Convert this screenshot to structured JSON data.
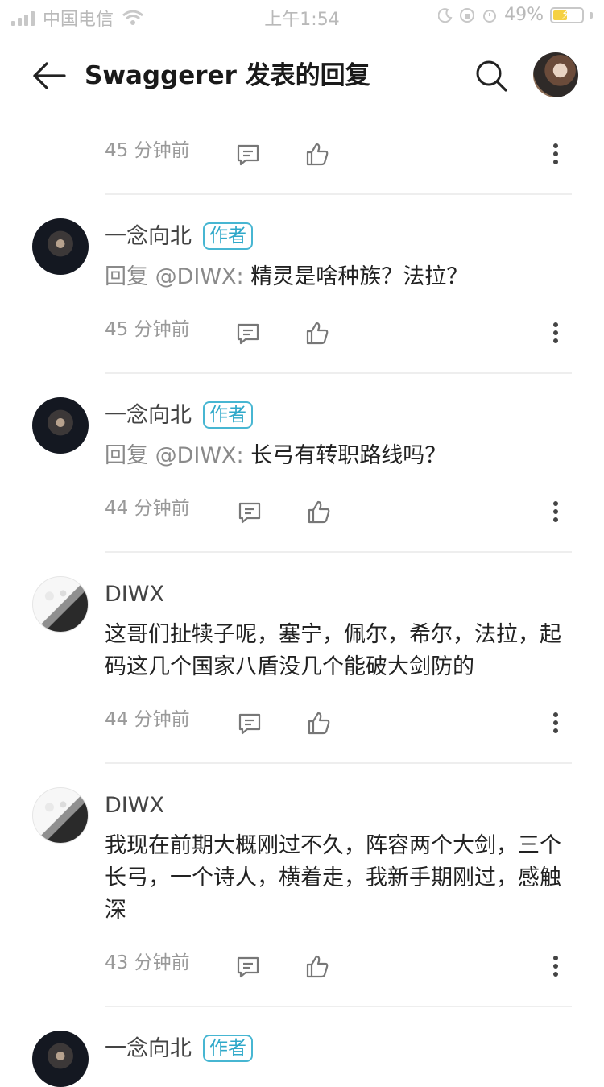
{
  "status": {
    "carrier": "中国电信",
    "time": "上午1:54",
    "battery": "49%",
    "battery_level": 0.49
  },
  "header": {
    "title": "Swaggerer 发表的回复",
    "back_icon": "back-arrow-icon",
    "search_icon": "search-icon"
  },
  "comments": [
    {
      "name": "",
      "badge": "",
      "text": "",
      "mention": "",
      "time": "45 分钟前"
    },
    {
      "name": "一念向北",
      "badge": "作者",
      "mention": "回复 @DIWX:",
      "text": "精灵是啥种族？法拉？",
      "time": "45 分钟前"
    },
    {
      "name": "一念向北",
      "badge": "作者",
      "mention": "回复 @DIWX:",
      "text": "长弓有转职路线吗？",
      "time": "44 分钟前"
    },
    {
      "name": "DIWX",
      "badge": "",
      "mention": "",
      "text": "这哥们扯犊子呢，塞宁，佩尔，希尔，法拉，起码这几个国家八盾没几个能破大剑防的",
      "time": "44 分钟前"
    },
    {
      "name": "DIWX",
      "badge": "",
      "mention": "",
      "text": "我现在前期大概刚过不久，阵容两个大剑，三个长弓，一个诗人，横着走，我新手期刚过，感触深",
      "time": "43 分钟前"
    },
    {
      "name": "一念向北",
      "badge": "作者",
      "mention": "",
      "text": "",
      "time": ""
    }
  ]
}
